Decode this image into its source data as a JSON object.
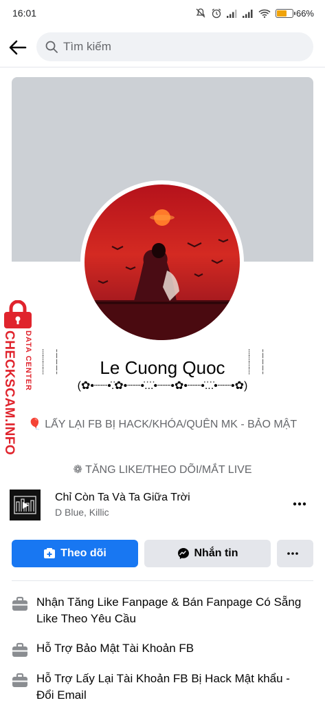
{
  "status_bar": {
    "time": "16:01",
    "battery_percent": "66%",
    "battery_level": 0.66,
    "icons": [
      "mute-icon",
      "alarm-icon",
      "signal-icon",
      "signal-icon",
      "wifi-icon",
      "battery-icon"
    ]
  },
  "search": {
    "placeholder": "Tìm kiếm"
  },
  "profile": {
    "name": "Le Cuong Quoc",
    "name_decoration": "(✿•┈┈•̇.̇✿•┈┈•̇.̇.̇.̇•┈┈•✿•┈┈•̇.̇.̇.̇•┈┈•✿)",
    "bio_line_1": "🎈 LẤY LẠI FB BỊ HACK/KHÓA/QUÊN MK - BẢO MẬT",
    "bio_line_2": "❁ TĂNG LIKE/THEO DÕI/MẮT LIVE"
  },
  "watermark": {
    "line_1": "DATA CENTER",
    "line_2": "CHECKSCAM.INFO",
    "color": "#e0242d"
  },
  "music": {
    "title": "Chỉ Còn Ta Và Ta Giữa Trời",
    "artist": "D Blue, Killic"
  },
  "actions": {
    "follow_label": "Theo dõi",
    "message_label": "Nhắn tin",
    "more_label": "···"
  },
  "intro": [
    {
      "text": "Nhận Tăng Like Fanpage & Bán Fanpage Có Sẵng Like Theo Yêu Cầu",
      "icon": "briefcase-icon"
    },
    {
      "text": "Hỗ Trợ Bảo Mật Tài Khoản FB",
      "icon": "briefcase-icon"
    },
    {
      "text": "Hỗ Trợ Lấy Lại Tài Khoản FB Bị Hack Mật khẩu - Đổi Email",
      "icon": "briefcase-icon"
    }
  ],
  "colors": {
    "brand_blue": "#1877f2",
    "secondary_button": "#e4e6eb",
    "muted_text": "#65676b"
  }
}
